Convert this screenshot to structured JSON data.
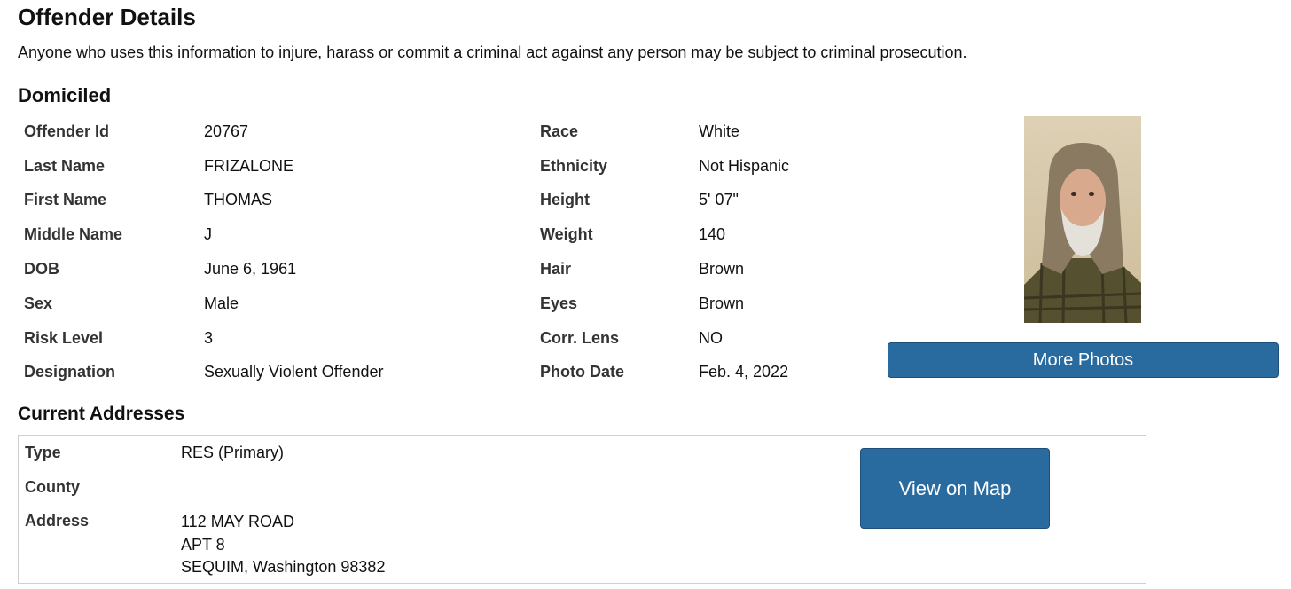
{
  "page": {
    "title": "Offender Details",
    "notice": "Anyone who uses this information to injure, harass or commit a criminal act against any person may be subject to criminal prosecution.",
    "domiciled_heading": "Domiciled",
    "addresses_heading": "Current Addresses"
  },
  "details": [
    {
      "label1": "Offender Id",
      "value1": "20767",
      "label2": "Race",
      "value2": "White"
    },
    {
      "label1": "Last Name",
      "value1": "FRIZALONE",
      "label2": "Ethnicity",
      "value2": "Not Hispanic"
    },
    {
      "label1": "First Name",
      "value1": "THOMAS",
      "label2": "Height",
      "value2": "5' 07\""
    },
    {
      "label1": "Middle Name",
      "value1": "J",
      "label2": "Weight",
      "value2": "140"
    },
    {
      "label1": "DOB",
      "value1": "June 6, 1961",
      "label2": "Hair",
      "value2": "Brown"
    },
    {
      "label1": "Sex",
      "value1": "Male",
      "label2": "Eyes",
      "value2": "Brown"
    },
    {
      "label1": "Risk Level",
      "value1": "3",
      "label2": "Corr. Lens",
      "value2": "NO"
    },
    {
      "label1": "Designation",
      "value1": "Sexually Violent Offender",
      "label2": "Photo Date",
      "value2": "Feb. 4, 2022"
    }
  ],
  "photo": {
    "buttonLabel": "More Photos"
  },
  "address": {
    "type_label": "Type",
    "type_value": "RES (Primary)",
    "county_label": "County",
    "county_value": "",
    "address_label": "Address",
    "lines": [
      "112 MAY ROAD",
      "APT 8",
      "SEQUIM, Washington 98382"
    ],
    "map_button": "View on Map"
  },
  "colors": {
    "button": "#2a6b9f",
    "button_text": "#ffffff"
  }
}
